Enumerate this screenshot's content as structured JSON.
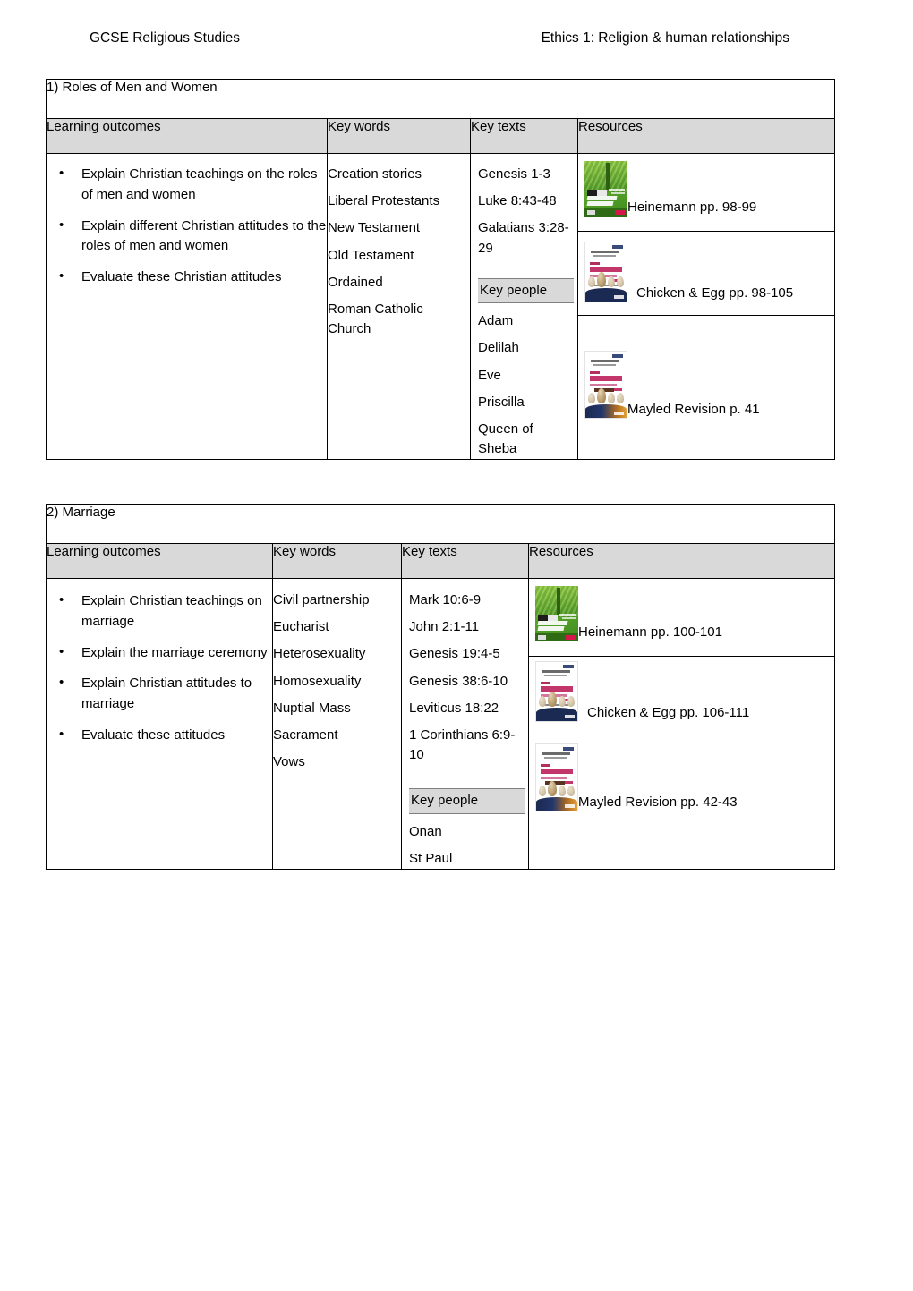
{
  "header": {
    "left": "GCSE Religious Studies",
    "right": "Ethics 1: Religion & human relationships"
  },
  "columns": {
    "learning_outcomes": "Learning outcomes",
    "key_words": "Key words",
    "key_texts": "Key texts",
    "resources": "Resources"
  },
  "key_people_label": "Key people",
  "tables": [
    {
      "title": "1) Roles of Men and Women",
      "learning_outcomes": [
        "Explain Christian teachings on the roles of men and women",
        "Explain different Christian attitudes to the roles of men and women",
        "Evaluate these Christian attitudes"
      ],
      "key_words": [
        "Creation stories",
        "Liberal Protestants",
        "New Testament",
        "Old Testament",
        "Ordained",
        "Roman Catholic Church"
      ],
      "key_texts": [
        "Genesis 1-3",
        "Luke 8:43-48",
        "Galatians 3:28-29"
      ],
      "key_people": [
        "Adam",
        "Delilah",
        "Eve",
        "Priscilla",
        "Queen of Sheba"
      ],
      "resources": [
        {
          "book": "heinemann",
          "label": "Heinemann pp. 98-99"
        },
        {
          "book": "chicken-egg",
          "label": "Chicken & Egg pp. 98-105"
        },
        {
          "book": "mayled-revision",
          "label": "Mayled Revision p. 41"
        }
      ]
    },
    {
      "title": "2) Marriage",
      "learning_outcomes": [
        "Explain Christian teachings on marriage",
        "Explain the marriage ceremony",
        "Explain Christian attitudes to marriage",
        "Evaluate these attitudes"
      ],
      "key_words": [
        "Civil partnership",
        "Eucharist",
        "Heterosexuality",
        "Homosexuality",
        "Nuptial Mass",
        "Sacrament",
        "Vows"
      ],
      "key_texts": [
        "Mark 10:6-9",
        "John 2:1-11",
        "Genesis 19:4-5",
        "Genesis 38:6-10",
        "Leviticus 18:22",
        "1 Corinthians 6:9-10"
      ],
      "key_people": [
        "Onan",
        "St Paul"
      ],
      "resources": [
        {
          "book": "heinemann",
          "label": "Heinemann pp. 100-101"
        },
        {
          "book": "chicken-egg",
          "label": "Chicken & Egg pp. 106-111"
        },
        {
          "book": "mayled-revision",
          "label": "Mayled Revision pp. 42-43"
        }
      ]
    }
  ],
  "colors": {
    "header_row_bg": "#d9d9d9",
    "key_people_bg": "#d9d9d9",
    "border": "#000000",
    "text": "#000000"
  }
}
